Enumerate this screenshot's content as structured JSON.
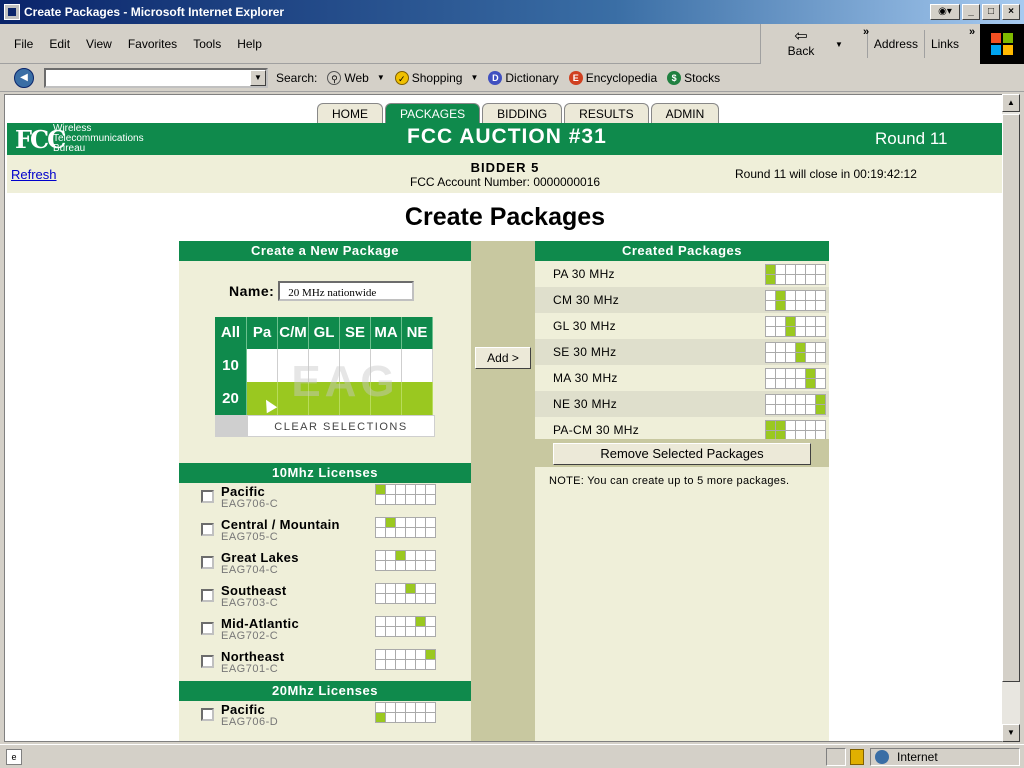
{
  "window": {
    "title": "Create Packages - Microsoft Internet Explorer"
  },
  "menu": [
    "File",
    "Edit",
    "View",
    "Favorites",
    "Tools",
    "Help"
  ],
  "nav": {
    "back": "Back",
    "address": "Address",
    "links": "Links"
  },
  "searchbar": {
    "search_label": "Search:",
    "items": [
      "Web",
      "Shopping",
      "Dictionary",
      "Encyclopedia",
      "Stocks"
    ]
  },
  "status": {
    "zone": "Internet"
  },
  "tabs": [
    "HOME",
    "PACKAGES",
    "BIDDING",
    "RESULTS",
    "ADMIN"
  ],
  "header": {
    "bureau_lines": [
      "Wireless",
      "Telecommunications",
      "Bureau"
    ],
    "logo": "FCC",
    "auction_title": "FCC AUCTION #31",
    "round": "Round 11"
  },
  "info": {
    "refresh": "Refresh",
    "bidder": "BIDDER 5",
    "account": "FCC Account Number: 0000000016",
    "close": "Round 11 will close in  00:19:42:12"
  },
  "page_title": "Create Packages",
  "new_package": {
    "heading": "Create a New Package",
    "name_label": "Name:",
    "name_value": "20 MHz nationwide",
    "grid_columns": [
      "All",
      "Pa",
      "C/M",
      "GL",
      "SE",
      "MA",
      "NE"
    ],
    "grid_rows": [
      "10",
      "20"
    ],
    "watermark": "EAG",
    "clear": "CLEAR SELECTIONS"
  },
  "licenses_10": {
    "heading": "10Mhz Licenses",
    "items": [
      {
        "name": "Pacific",
        "code": "EAG706-C",
        "cell": 0
      },
      {
        "name": "Central / Mountain",
        "code": "EAG705-C",
        "cell": 1
      },
      {
        "name": "Great Lakes",
        "code": "EAG704-C",
        "cell": 2
      },
      {
        "name": "Southeast",
        "code": "EAG703-C",
        "cell": 3
      },
      {
        "name": "Mid-Atlantic",
        "code": "EAG702-C",
        "cell": 4
      },
      {
        "name": "Northeast",
        "code": "EAG701-C",
        "cell": 5
      }
    ]
  },
  "licenses_20": {
    "heading": "20Mhz Licenses",
    "items": [
      {
        "name": "Pacific",
        "code": "EAG706-D",
        "cell": 6
      }
    ]
  },
  "add_button": "Add >",
  "created": {
    "heading": "Created Packages",
    "items": [
      {
        "name": "PA 30 MHz",
        "cells": [
          0,
          6
        ]
      },
      {
        "name": "CM 30 MHz",
        "cells": [
          1,
          7
        ]
      },
      {
        "name": "GL 30 MHz",
        "cells": [
          2,
          8
        ]
      },
      {
        "name": "SE 30 MHz",
        "cells": [
          3,
          9
        ]
      },
      {
        "name": "MA 30 MHz",
        "cells": [
          4,
          10
        ]
      },
      {
        "name": "NE 30 MHz",
        "cells": [
          5,
          11
        ]
      },
      {
        "name": "PA-CM 30 MHz",
        "cells": [
          0,
          1,
          6,
          7
        ]
      }
    ],
    "remove": "Remove Selected Packages",
    "note": "NOTE: You can create up to 5 more packages."
  }
}
